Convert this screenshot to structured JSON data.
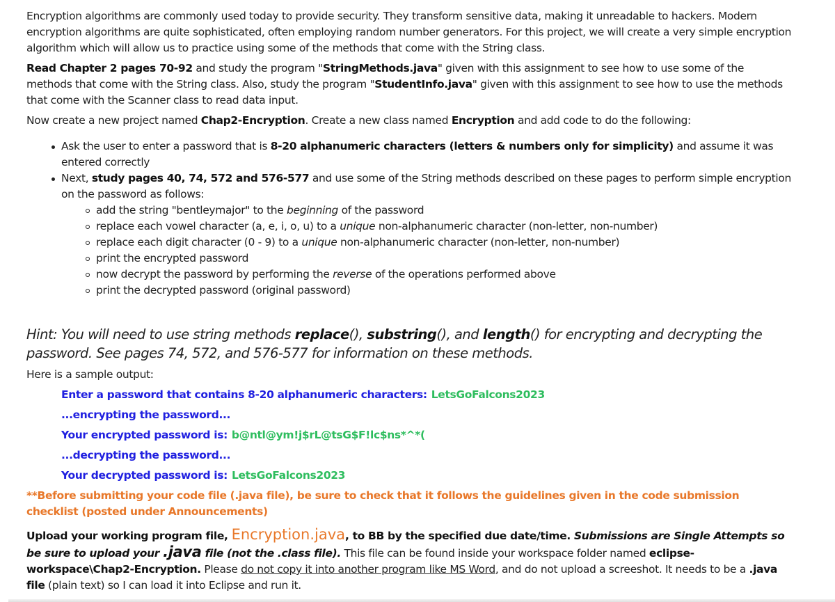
{
  "intro": {
    "p1": "Encryption algorithms are commonly used today to provide security.  They transform sensitive data, making it unreadable to hackers. Modern encryption algorithms are quite sophisticated, often employing random number generators.  For this project, we will create a very simple encryption algorithm which will allow us to practice using some of the methods that come with the String class.",
    "p2_bold": "Read Chapter 2 pages 70-92",
    "p2_a": " and study the program \"",
    "p2_file1": "StringMethods.java",
    "p2_b": "\" given with this assignment to see how to use some of the methods that come with the String class.  Also, study the program \"",
    "p2_file2": "StudentInfo.java",
    "p2_c": "\" given with this assignment to see how to use the methods that come with the Scanner class to read data input.",
    "p3_a": "Now create a new project named ",
    "p3_project": "Chap2-Encryption",
    "p3_b": ".  Create a new class named ",
    "p3_class": "Encryption",
    "p3_c": " and add code to do the following:"
  },
  "steps": {
    "s1_a": "Ask the user to enter a password that is ",
    "s1_bold": "8-20 alphanumeric characters (letters & numbers only for simplicity)",
    "s1_b": " and assume it was entered correctly",
    "s2_a": "Next, ",
    "s2_bold": "study pages 40, 74, 572 and 576-577",
    "s2_b": " and use some of the String methods described on these pages to perform simple encryption on the password as follows:",
    "sub": {
      "a1": "add the string \"bentleymajor\" to the ",
      "a1_em": "beginning",
      "a1_b": " of the password",
      "a2": "replace each vowel character (a, e, i, o, u) to a ",
      "a2_em": "unique",
      "a2_b": " non-alphanumeric character (non-letter, non-number)",
      "a3": "replace each digit character (0 - 9) to a ",
      "a3_em": "unique",
      "a3_b": " non-alphanumeric character (non-letter, non-number)",
      "a4": "print the encrypted password",
      "a5": "now decrypt the password by performing the ",
      "a5_em": "reverse",
      "a5_b": " of the operations performed above",
      "a6": "print the decrypted password (original password)"
    }
  },
  "hint": {
    "a": "Hint:  You will need to use string methods ",
    "m1": "replace",
    "b": "(), ",
    "m2": "substring",
    "c": "(), and ",
    "m3": "length",
    "d": "() for encrypting and decrypting the password.  See pages 74, 572, and 576-577 for information on these methods."
  },
  "sample": {
    "intro": "Here is a sample output:",
    "lines": [
      {
        "label": "Enter a password that contains 8-20 alphanumeric characters:",
        "value": "LetsGoFalcons2023"
      },
      {
        "label": "...encrypting the password...",
        "value": ""
      },
      {
        "label": "Your encrypted password is:",
        "value": "b@ntl@ym!j$rL@tsG$F!lc$ns*^*("
      },
      {
        "label": "...decrypting the password...",
        "value": ""
      },
      {
        "label": "Your decrypted password is:",
        "value": "LetsGoFalcons2023"
      }
    ]
  },
  "note": "**Before submitting your code file (.java file), be sure to check that it follows the guidelines given in the code submission checklist (posted under Announcements)",
  "upload": {
    "a": "Upload your working program file, ",
    "file": "Encryption.java",
    "b": ", to BB by the specified due date/time. ",
    "em1": "Submissions are Single Attempts so be sure to upload your ",
    "em_java": ".java",
    "em2": " file (not the .class file).",
    "c": " This file can be found inside your workspace folder named ",
    "folder": "eclipse-workspace\\Chap2-Encryption.",
    "d": " Please ",
    "underline": "do not copy it into another program like MS Word",
    "e": ", and do not upload a screeshot.  It needs to be a ",
    "javafile": ".java file",
    "f": " (plain text) so I can load it into Eclipse and run it."
  },
  "colors": {
    "sample_label": "#2020e0",
    "sample_value": "#2ebd5e",
    "note": "#e8782a"
  }
}
